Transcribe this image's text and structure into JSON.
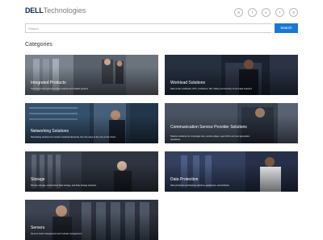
{
  "header": {
    "brand": "DELL",
    "brand_rest": "Technologies",
    "social_icons": [
      "in",
      "f",
      "▸",
      "t",
      "✆"
    ]
  },
  "search": {
    "placeholder": "Search",
    "button_label": "Search"
  },
  "section_title": "Categories",
  "cards": [
    {
      "title": "Integrated Products",
      "desc": "Converged and hyperconverged systems and related systems"
    },
    {
      "title": "Workload Solutions",
      "desc": "Data center workloads, HPC, containers, VDI, Safety and Security, AI and data analytics"
    },
    {
      "title": "Networking Solutions",
      "desc": "Networking solutions for modern workload demands, from the edge to the core to the Cloud"
    },
    {
      "title": "Communication Service Provider Solutions",
      "desc": "Telecom solutions for converged core, service edges, open RAN, and next generation",
      "desc2": "operations"
    },
    {
      "title": "Storage",
      "desc": "Primary storage, unstructured data storage, and data storage solutions"
    },
    {
      "title": "Data Protection",
      "desc": "Data protection and backup solutions, appliances, and software"
    },
    {
      "title": "Servers",
      "desc": "Servers, Rack management and modular management"
    }
  ],
  "colors": {
    "accent": "#1b77d2",
    "brand": "#0b2a4a"
  }
}
